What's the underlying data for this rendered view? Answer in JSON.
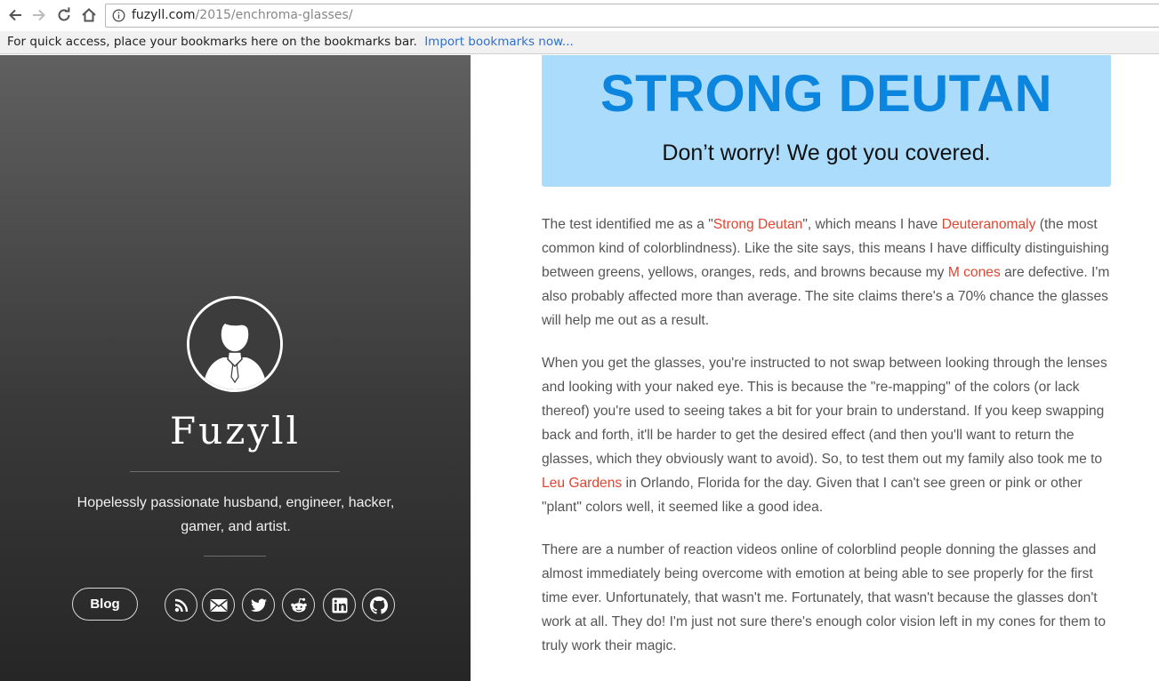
{
  "browser": {
    "url_host": "fuzyll.com",
    "url_path": "/2015/enchroma-glasses/",
    "bookmarks_bar_message": "For quick access, place your bookmarks here on the bookmarks bar.",
    "bookmarks_bar_link": "Import bookmarks now..."
  },
  "sidebar": {
    "site_name": "Fuzyll",
    "tagline": "Hopelessly passionate husband, engineer, hacker, gamer, and artist.",
    "blog_button": "Blog",
    "social_icons": [
      "rss-icon",
      "email-icon",
      "twitter-icon",
      "reddit-icon",
      "linkedin-icon",
      "github-icon"
    ]
  },
  "banner": {
    "title": "STRONG DEUTAN",
    "subtitle": "Don’t worry! We got you covered.",
    "background_color": "#abdcfc",
    "title_color": "#0b85dd"
  },
  "article": {
    "link_color": "#e0452f",
    "p1": {
      "t1": "The test identified me as a \"",
      "link1": "Strong Deutan",
      "t2": "\", which means I have ",
      "link2": "Deuteranomaly",
      "t3": " (the most common kind of colorblindness). Like the site says, this means I have difficulty distinguishing between greens, yellows, oranges, reds, and browns because my ",
      "link3": "M cones",
      "t4": " are defective. I'm also probably affected more than average. The site claims there's a 70% chance the glasses will help me out as a result."
    },
    "p2": {
      "t1": "When you get the glasses, you're instructed to not swap between looking through the lenses and looking with your naked eye. This is because the \"re-mapping\" of the colors (or lack thereof) you're used to seeing takes a bit for your brain to understand. If you keep swapping back and forth, it'll be harder to get the desired effect (and then you'll want to return the glasses, which they obviously want to avoid). So, to test them out my family also took me to ",
      "link1": "Leu Gardens",
      "t2": " in Orlando, Florida for the day. Given that I can't see green or pink or other \"plant\" colors well, it seemed like a good idea."
    },
    "p3": "There are a number of reaction videos online of colorblind people donning the glasses and almost immediately being overcome with emotion at being able to see properly for the first time ever. Unfortunately, that wasn't me. Fortunately, that wasn't because the glasses don't work at all. They do! I'm just not sure there's enough color vision left in my cones for them to truly work their magic."
  }
}
